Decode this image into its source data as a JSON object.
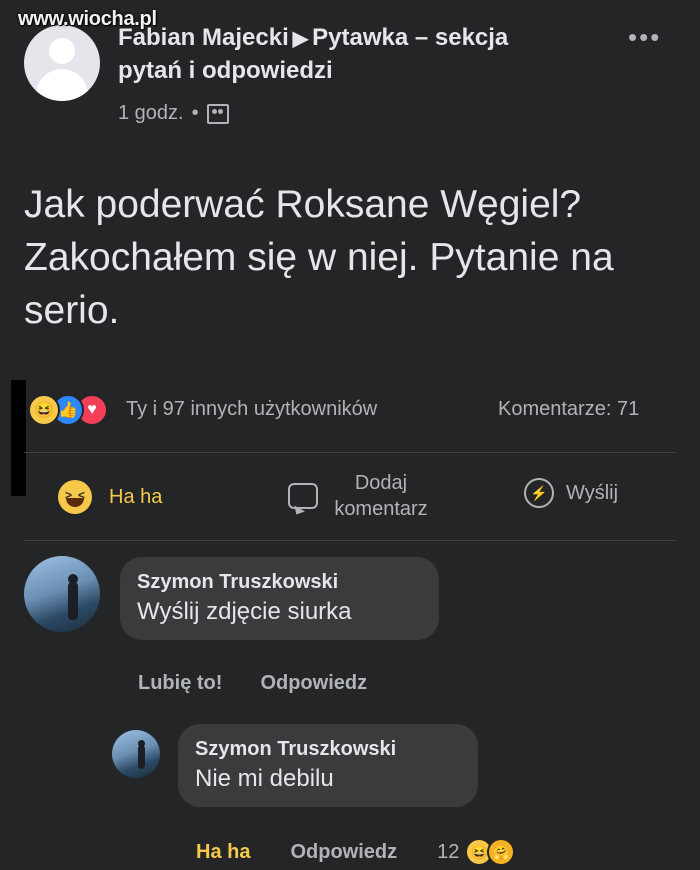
{
  "watermark": "www.wiocha.pl",
  "post": {
    "author": "Fabian Majecki",
    "separator_icon": "triangle-right-icon",
    "group": "Pytawka – sekcja pytań i odpowiedzi",
    "time": "1 godz.",
    "dot": "•",
    "privacy_icon": "group-icon",
    "more_icon": "•••",
    "text": "Jak poderwać Roksane Węgiel? Zakochałem się w niej. Pytanie na serio."
  },
  "reactions": {
    "icons": [
      "haha",
      "like",
      "love"
    ],
    "summary": "Ty i 97 innych użytkowników",
    "comments": "Komentarze: 71"
  },
  "actions": {
    "haha": "Ha ha",
    "comment_line1": "Dodaj",
    "comment_line2": "komentarz",
    "share": "Wyślij"
  },
  "comments": [
    {
      "author": "Szymon Truszkowski",
      "text": "Wyślij zdjęcie siurka",
      "like": "Lubię to!",
      "reply": "Odpowiedz"
    },
    {
      "author": "Szymon Truszkowski",
      "text": "Nie mi debilu",
      "like": "Ha ha",
      "reply": "Odpowiedz",
      "reaction_count": "12"
    }
  ],
  "colors": {
    "background": "#242526",
    "bubble": "#3a3b3c",
    "haha_accent": "#f7c94a",
    "like_blue": "#2d88ff",
    "love_red": "#f33e58"
  }
}
